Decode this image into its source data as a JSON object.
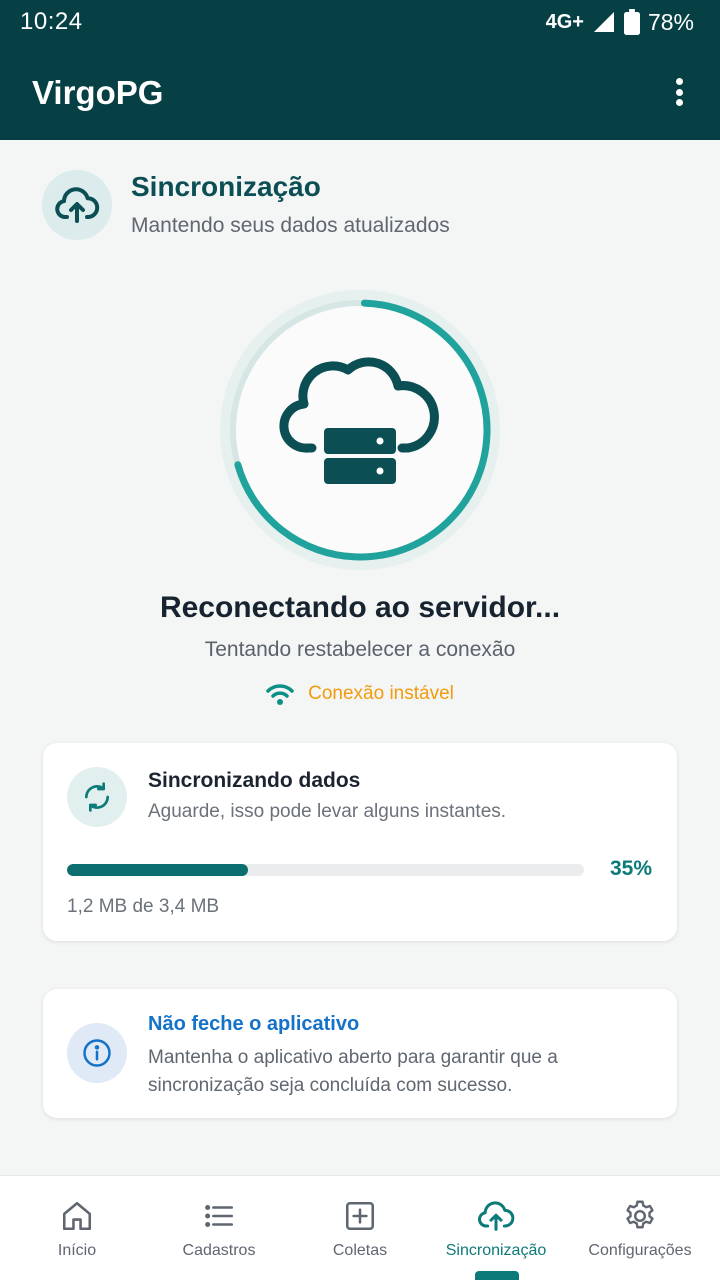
{
  "status_bar": {
    "time": "10:24",
    "network": "4G+",
    "battery": "78%",
    "icons": [
      "signal-icon",
      "battery-icon"
    ]
  },
  "app_bar": {
    "title": "VirgoPG",
    "menu_icon": "more-vert-icon"
  },
  "header": {
    "icon": "cloud-upload-icon",
    "title": "Sincronização",
    "subtitle": "Mantendo seus dados atualizados"
  },
  "status": {
    "icon": "cloud-server-icon",
    "title": "Reconectando ao servidor...",
    "subtitle": "Tentando restabelecer a conexão",
    "connection_icon": "wifi-icon",
    "connection_text": "Conexão instável"
  },
  "sync_card": {
    "icon": "sync-icon",
    "title": "Sincronizando dados",
    "subtitle": "Aguarde, isso pode levar alguns instantes.",
    "progress_percent": 35,
    "progress_label": "35%",
    "size_text": "1,2 MB de 3,4 MB"
  },
  "warning_card": {
    "icon": "info-icon",
    "title": "Não feche o aplicativo",
    "body": "Mantenha o aplicativo aberto para garantir que a sincronização seja concluída com sucesso."
  },
  "bottom_nav": {
    "items": [
      {
        "label": "Início",
        "icon": "home-icon",
        "active": false
      },
      {
        "label": "Cadastros",
        "icon": "list-icon",
        "active": false
      },
      {
        "label": "Coletas",
        "icon": "add-box-icon",
        "active": false
      },
      {
        "label": "Sincronização",
        "icon": "cloud-upload-icon",
        "active": true
      },
      {
        "label": "Configurações",
        "icon": "gear-icon",
        "active": false
      }
    ]
  },
  "colors": {
    "primary_dark": "#063f44",
    "accent": "#0c7a78",
    "ring_accent": "#20a39c",
    "warning": "#f29b0c",
    "info": "#1473c8"
  }
}
